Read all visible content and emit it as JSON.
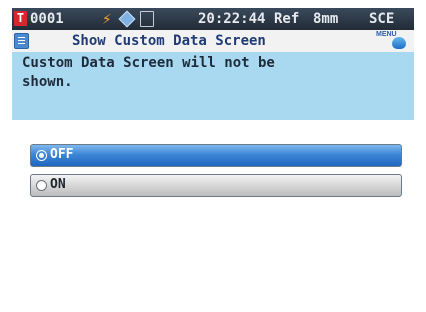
{
  "status_bar": {
    "target_badge": "T",
    "sample_no": "0001",
    "time": "20:22:44",
    "reference": "Ref",
    "area": "8mm",
    "mode": "SCE"
  },
  "title_bar": {
    "title": "Show Custom Data Screen",
    "menu_label": "MENU"
  },
  "description": "Custom Data Screen will not be\nshown.",
  "options": [
    {
      "label": "OFF",
      "selected": true
    },
    {
      "label": "ON",
      "selected": false
    }
  ],
  "colors": {
    "accent": "#3d86d6",
    "description_background": "#a9d8f1",
    "status_bar": "#2b3542"
  }
}
